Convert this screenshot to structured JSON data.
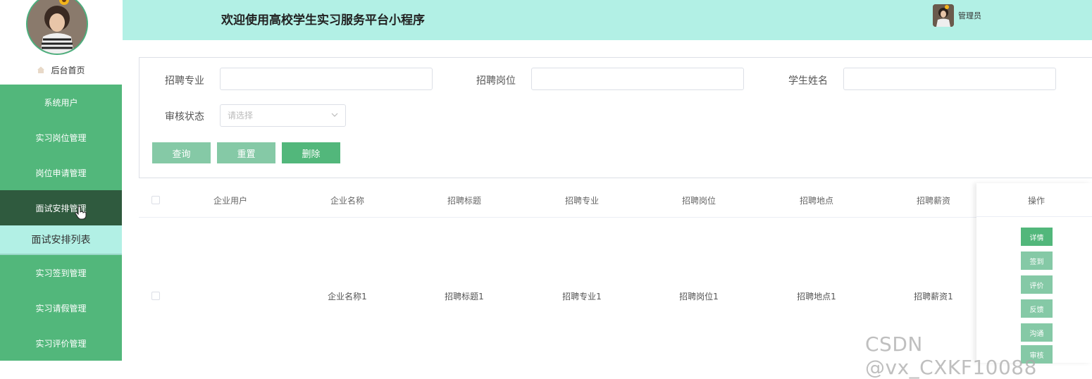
{
  "header": {
    "title": "欢迎使用高校学生实习服务平台小程序",
    "user_name": "管理员"
  },
  "sidebar": {
    "home_label": "后台首页",
    "items": [
      {
        "label": "系统用户"
      },
      {
        "label": "实习岗位管理"
      },
      {
        "label": "岗位申请管理"
      },
      {
        "label": "面试安排管理"
      },
      {
        "label": "实习签到管理"
      },
      {
        "label": "实习请假管理"
      },
      {
        "label": "实习评价管理"
      }
    ],
    "active_sub_label": "面试安排列表"
  },
  "search": {
    "major_label": "招聘专业",
    "position_label": "招聘岗位",
    "student_label": "学生姓名",
    "status_label": "审核状态",
    "status_placeholder": "请选择",
    "query_label": "查询",
    "reset_label": "重置",
    "delete_label": "删除"
  },
  "table": {
    "columns": [
      "企业用户",
      "企业名称",
      "招聘标题",
      "招聘专业",
      "招聘岗位",
      "招聘地点",
      "招聘薪资",
      "操作"
    ],
    "rows": [
      {
        "company_user": "",
        "company_name": "企业名称1",
        "title": "招聘标题1",
        "major": "招聘专业1",
        "position": "招聘岗位1",
        "location": "招聘地点1",
        "salary": "招聘薪资1"
      }
    ],
    "actions": [
      "详情",
      "签到",
      "评价",
      "反馈",
      "沟通",
      "审核"
    ]
  },
  "watermark": "CSDN @vx_CXKF10088",
  "colors": {
    "accent": "#52b77b",
    "accent_light": "#85c9a6",
    "header_bg": "#b2f0e5",
    "active_menu": "#2f5a3e"
  }
}
